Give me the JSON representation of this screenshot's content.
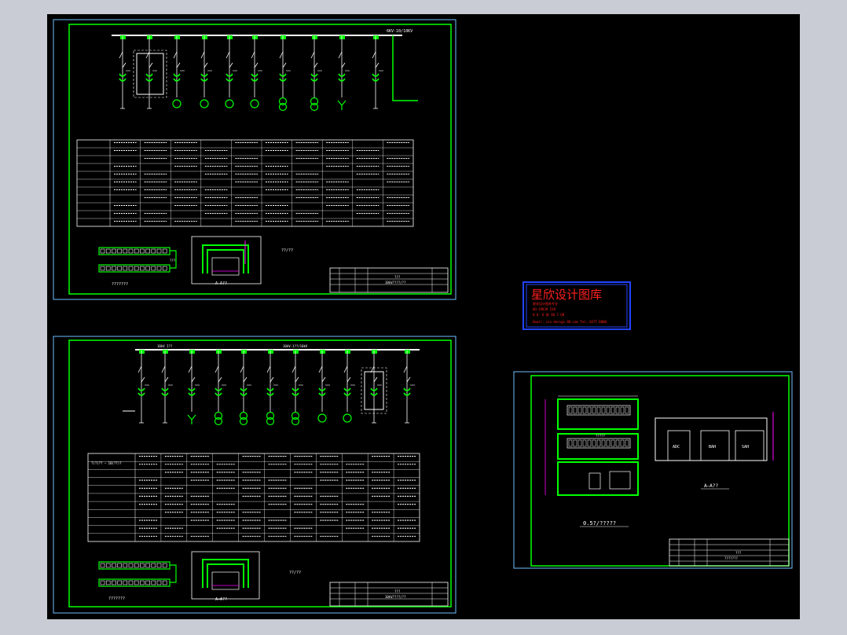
{
  "colors": {
    "background": "#000000",
    "border": "#00ff00",
    "frame": "#70c0ff",
    "line": "#ffffff",
    "highlight": "#00ff00",
    "label": "#ff00ff",
    "watermark_border": "#2244ff",
    "watermark_text": "#ff2020"
  },
  "sheets": {
    "top_left": {
      "bus_label": "6KV-10/10KV",
      "plan_note": "??/??",
      "section_label": "A—A??",
      "legend_label": "???????",
      "dim_label": "???",
      "title_block": {
        "label_a": "???",
        "label_b": "10kV????/??"
      }
    },
    "bottom_left": {
      "bus_label_a": "10kV I??",
      "bus_label_b": "10kV-1??/10kV",
      "header_row": "?(?)?? — 10(??)?",
      "plan_note": "??/??",
      "section_label": "A—A??",
      "legend_label": "???????",
      "title_block": {
        "label_a": "???",
        "label_b": "10kV????/??"
      }
    },
    "right": {
      "caption": "0.5?/?????",
      "section_label": "A—A??",
      "room_label": "?????",
      "labels": [
        "ADC",
        "BAH",
        "SAH"
      ],
      "title_block": {
        "label_a": "???",
        "label_b": "???????"
      }
    }
  },
  "watermark": {
    "title": "星欣设计图库",
    "lines": [
      "星欣设计图库专业",
      "QQ:19839 538",
      "Q-Q-  Q  群  QQ C  QB",
      "Email: xin-design 88.com  Tel: 0377-8000"
    ]
  }
}
